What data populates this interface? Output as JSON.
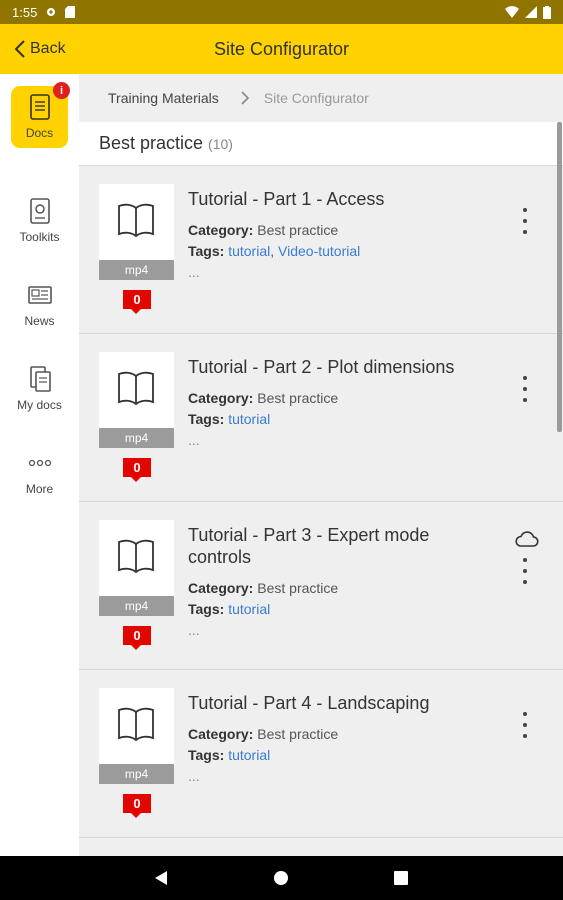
{
  "status": {
    "time": "1:55"
  },
  "appbar": {
    "back_label": "Back",
    "title": "Site Configurator"
  },
  "sidebar": {
    "items": [
      {
        "label": "Docs",
        "icon": "document-icon",
        "active": true,
        "badge": "i"
      },
      {
        "label": "Toolkits",
        "icon": "toolkit-icon"
      },
      {
        "label": "News",
        "icon": "news-icon"
      },
      {
        "label": "My docs",
        "icon": "my-docs-icon"
      },
      {
        "label": "More",
        "icon": "more-dots-icon"
      }
    ]
  },
  "breadcrumb": {
    "parent": "Training Materials",
    "current": "Site Configurator"
  },
  "section": {
    "title": "Best practice",
    "count": "(10)"
  },
  "labels": {
    "category": "Category:",
    "tags": "Tags:",
    "ellipsis": "..."
  },
  "cards": [
    {
      "title": "Tutorial - Part 1 - Access",
      "category": "Best practice",
      "tags": "tutorial",
      "tags_sep": ", ",
      "tags2": "Video-tutorial",
      "type": "mp4",
      "comments": "0"
    },
    {
      "title": "Tutorial - Part 2 - Plot dimensions",
      "category": "Best practice",
      "tags": "tutorial",
      "type": "mp4",
      "comments": "0"
    },
    {
      "title": "Tutorial - Part 3 - Expert mode controls",
      "category": "Best practice",
      "tags": "tutorial",
      "type": "mp4",
      "comments": "0",
      "cloud": true
    },
    {
      "title": "Tutorial - Part 4 - Landscaping",
      "category": "Best practice",
      "tags": "tutorial",
      "type": "mp4",
      "comments": "0"
    }
  ],
  "colors": {
    "accent": "#ffd200",
    "badge": "#e10600",
    "link": "#3a7bd5"
  }
}
